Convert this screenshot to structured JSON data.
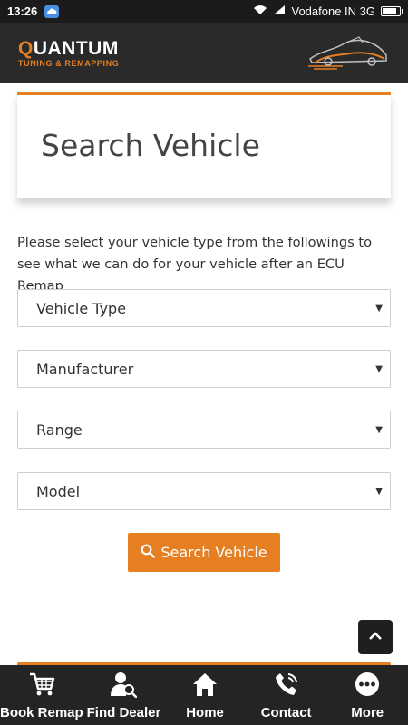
{
  "status_bar": {
    "time": "13:26",
    "carrier": "Vodafone IN 3G",
    "battery_level": 0.85
  },
  "header": {
    "brand_first": "Q",
    "brand_rest": "UANTUM",
    "tagline": "TUNING & REMAPPING"
  },
  "page": {
    "title": "Search Vehicle",
    "intro": "Please select your vehicle type from the followings to see what we can do for your vehicle after an ECU Remap"
  },
  "form": {
    "vehicle_type": "Vehicle Type",
    "manufacturer": "Manufacturer",
    "range": "Range",
    "model": "Model",
    "caret": "▼",
    "search_label": "Search Vehicle"
  },
  "bottom_nav": {
    "book_remap": "Book Remap",
    "find_dealer": "Find Dealer",
    "home": "Home",
    "contact": "Contact",
    "more": "More"
  },
  "colors": {
    "accent": "#e67e22",
    "header_bg": "#2a2a2a",
    "nav_bg": "#242424"
  }
}
